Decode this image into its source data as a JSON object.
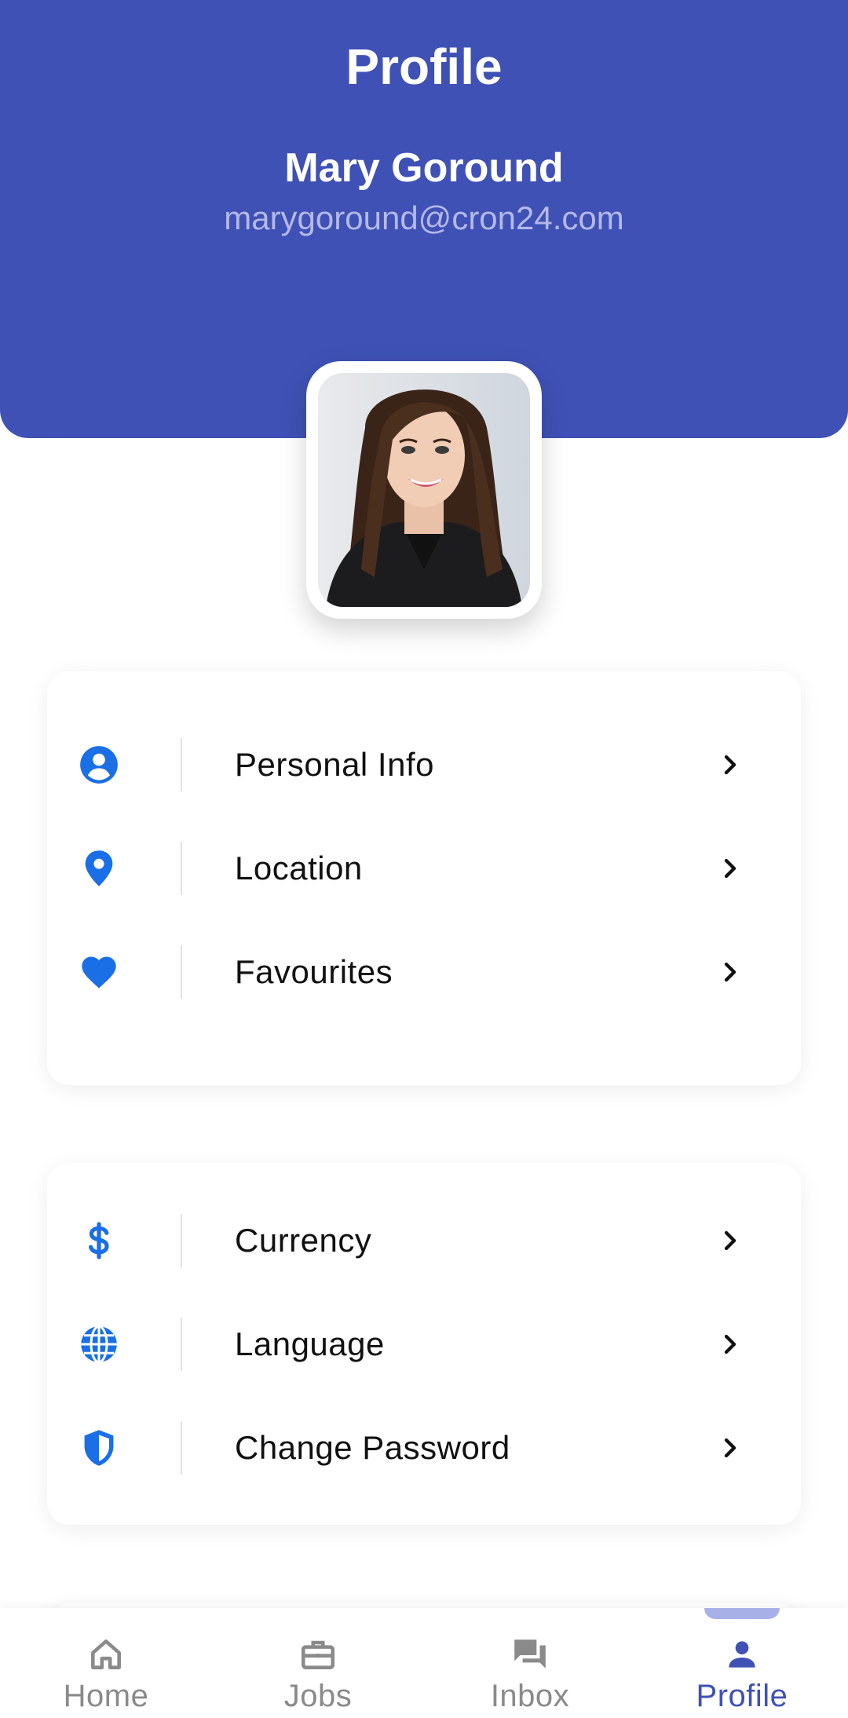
{
  "header": {
    "title": "Profile",
    "name": "Mary Goround",
    "email": "marygoround@cron24.com"
  },
  "colors": {
    "primary": "#3f51b5",
    "icon_blue": "#1a6fe6",
    "nav_inactive": "#8a8a8a"
  },
  "menu_group_1": [
    {
      "label": "Personal Info",
      "icon": "account-circle-icon"
    },
    {
      "label": "Location",
      "icon": "location-pin-icon"
    },
    {
      "label": "Favourites",
      "icon": "heart-icon"
    }
  ],
  "menu_group_2": [
    {
      "label": "Currency",
      "icon": "dollar-icon"
    },
    {
      "label": "Language",
      "icon": "globe-icon"
    },
    {
      "label": "Change Password",
      "icon": "shield-icon"
    }
  ],
  "nav": {
    "items": [
      {
        "label": "Home",
        "icon": "home-icon"
      },
      {
        "label": "Jobs",
        "icon": "briefcase-icon"
      },
      {
        "label": "Inbox",
        "icon": "chat-icon"
      },
      {
        "label": "Profile",
        "icon": "person-icon"
      }
    ],
    "active": "Profile"
  }
}
